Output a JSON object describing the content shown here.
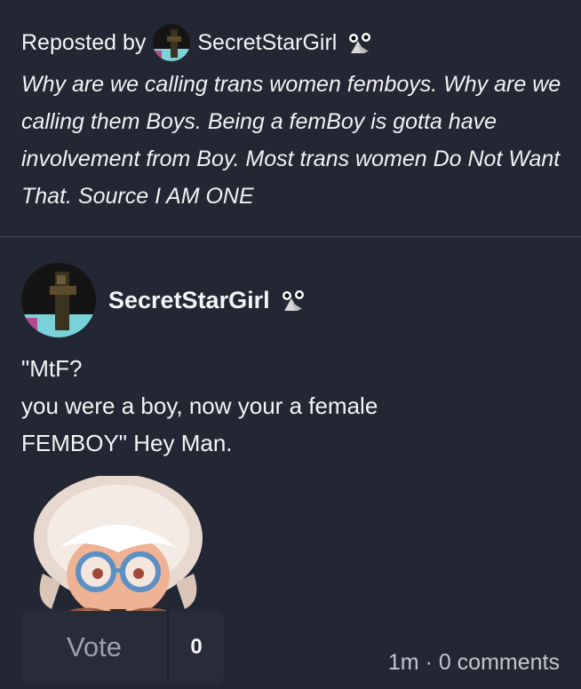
{
  "repost": {
    "label": "Reposted by",
    "username": "SecretStarGirl",
    "quote": "Why are we calling trans women femboys. Why are we calling them Boys. Being a femBoy is gotta have involvement from Boy. Most trans women Do Not Want That. Source I AM ONE",
    "avatar_icon": "user-avatar",
    "badge_icon": "flower-badge-icon"
  },
  "post": {
    "username": "SecretStarGirl",
    "badge_icon": "flower-badge-icon",
    "avatar_icon": "user-avatar",
    "lines": [
      "\"MtF?",
      "you were a boy, now your a female",
      "FEMBOY\" Hey Man."
    ],
    "sticker_icon": "cartoon-character-sticker"
  },
  "actions": {
    "vote_label": "Vote",
    "vote_count": "0"
  },
  "meta": {
    "text": "1m · 0 comments"
  },
  "colors": {
    "background": "#222733",
    "divider": "#4a4f5c",
    "vote_bg": "#272c38",
    "muted_text": "#c3c6cf"
  }
}
